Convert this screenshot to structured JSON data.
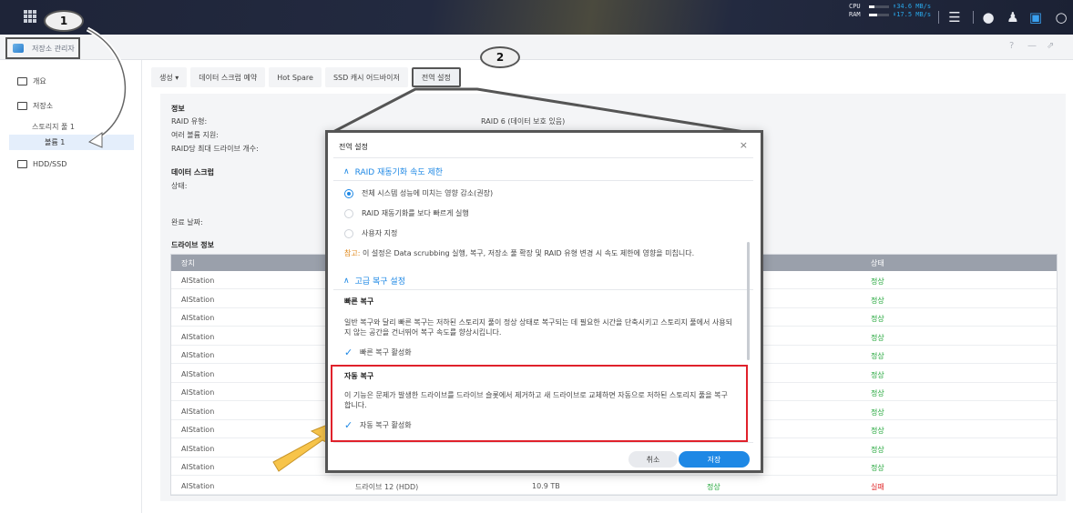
{
  "topbar": {
    "cpu_label": "CPU",
    "ram_label": "RAM",
    "cpu_rate": "⬆34.6 MB/s",
    "ram_rate": "⬇17.5 MB/s",
    "cpu_usage_fraction": 0.25,
    "ram_usage_fraction": 0.4,
    "icons": [
      "grid-icon",
      "storage-icon",
      "chat-icon",
      "user-icon",
      "widget-icon",
      "search-icon"
    ]
  },
  "app": {
    "title": "저장소 관리자",
    "window_controls": [
      "?",
      "—",
      "⇗"
    ]
  },
  "sidebar": {
    "items": [
      {
        "label": "개요"
      },
      {
        "label": "저장소"
      },
      {
        "label": "스토리지 풀 1"
      },
      {
        "label": "볼륨 1"
      },
      {
        "label": "HDD/SSD"
      }
    ]
  },
  "tabs": [
    {
      "label": "생성 ▾"
    },
    {
      "label": "데이터 스크럽 예약"
    },
    {
      "label": "Hot Spare"
    },
    {
      "label": "SSD 캐시 어드바이저"
    },
    {
      "label": "전역 설정"
    }
  ],
  "info": {
    "heading": "정보",
    "raid_type_label": "RAID 유형:",
    "raid_type_value": "RAID 6 (데이터 보호 있음)",
    "multi_volume_label": "여러 볼륨 지원:",
    "max_drives_label": "RAID당 최대 드라이브 개수:",
    "scrub_heading": "데이터 스크럽",
    "status_label": "상태:",
    "completed_label": "완료 날짜:",
    "drive_heading": "드라이브 정보"
  },
  "drive_table": {
    "headers": {
      "location": "장치",
      "status": "상태"
    },
    "rows": [
      {
        "device": "AIStation",
        "drive": "",
        "size": "",
        "health": "",
        "status": "정상",
        "bad": false
      },
      {
        "device": "AIStation",
        "drive": "",
        "size": "",
        "health": "",
        "status": "정상",
        "bad": false
      },
      {
        "device": "AIStation",
        "drive": "",
        "size": "",
        "health": "",
        "status": "정상",
        "bad": false
      },
      {
        "device": "AIStation",
        "drive": "",
        "size": "",
        "health": "",
        "status": "정상",
        "bad": false
      },
      {
        "device": "AIStation",
        "drive": "",
        "size": "",
        "health": "",
        "status": "정상",
        "bad": false
      },
      {
        "device": "AIStation",
        "drive": "",
        "size": "",
        "health": "",
        "status": "정상",
        "bad": false
      },
      {
        "device": "AIStation",
        "drive": "",
        "size": "",
        "health": "",
        "status": "정상",
        "bad": false
      },
      {
        "device": "AIStation",
        "drive": "",
        "size": "",
        "health": "",
        "status": "정상",
        "bad": false
      },
      {
        "device": "AIStation",
        "drive": "",
        "size": "",
        "health": "",
        "status": "정상",
        "bad": false
      },
      {
        "device": "AIStation",
        "drive": "",
        "size": "",
        "health": "",
        "status": "정상",
        "bad": false
      },
      {
        "device": "AIStation",
        "drive": "",
        "size": "",
        "health": "",
        "status": "정상",
        "bad": false
      },
      {
        "device": "AIStation",
        "drive": "드라이브 12 (HDD)",
        "size": "10.9 TB",
        "health": "정상",
        "status": "실패",
        "bad": true
      }
    ]
  },
  "dialog": {
    "title": "전역 설정",
    "close": "×",
    "section1": "RAID 재동기화 속도 제한",
    "options": [
      {
        "label": "전체 시스템 성능에 미치는 영향 감소(권장)",
        "selected": true
      },
      {
        "label": "RAID 재동기화를 보다 빠르게 실행",
        "selected": false
      },
      {
        "label": "사용자 지정",
        "selected": false
      }
    ],
    "note_label": "참고:",
    "note_text": "이 설정은 Data scrubbing 실행, 복구, 저장소 풀 확장 및 RAID 유형 변경 시 속도 제한에 영향을 미칩니다.",
    "section2": "고급 복구 설정",
    "fast_heading": "빠른 복구",
    "fast_desc_1": "일반 복구와 달리 빠른 복구는 저하된 스토리지 풀이 정상 상태로 복구되는 데 필요한 시간을 단축시키고 스토리지 풀에서 사용되",
    "fast_desc_2": "지 않는 공간을 건너뛰어 복구 속도를 향상시킵니다.",
    "fast_check": "빠른 복구 활성화",
    "fast_checked": true,
    "auto_heading": "자동 복구",
    "auto_desc_1": "이 기능은 문제가 발생한 드라이브를 드라이브 슬롯에서 제거하고 새 드라이브로 교체하면 자동으로 저하된 스토리지 풀을 복구",
    "auto_desc_2": "합니다.",
    "auto_check": "자동 복구 활성화",
    "auto_checked": true,
    "cancel": "취소",
    "save": "저장"
  },
  "callouts": {
    "one": "1",
    "two": "2"
  },
  "colors": {
    "accent": "#1e88e5",
    "ok": "#22a63a",
    "fail": "#e0282a",
    "highlight": "#e0212b",
    "arrow": "#f7c44a"
  }
}
